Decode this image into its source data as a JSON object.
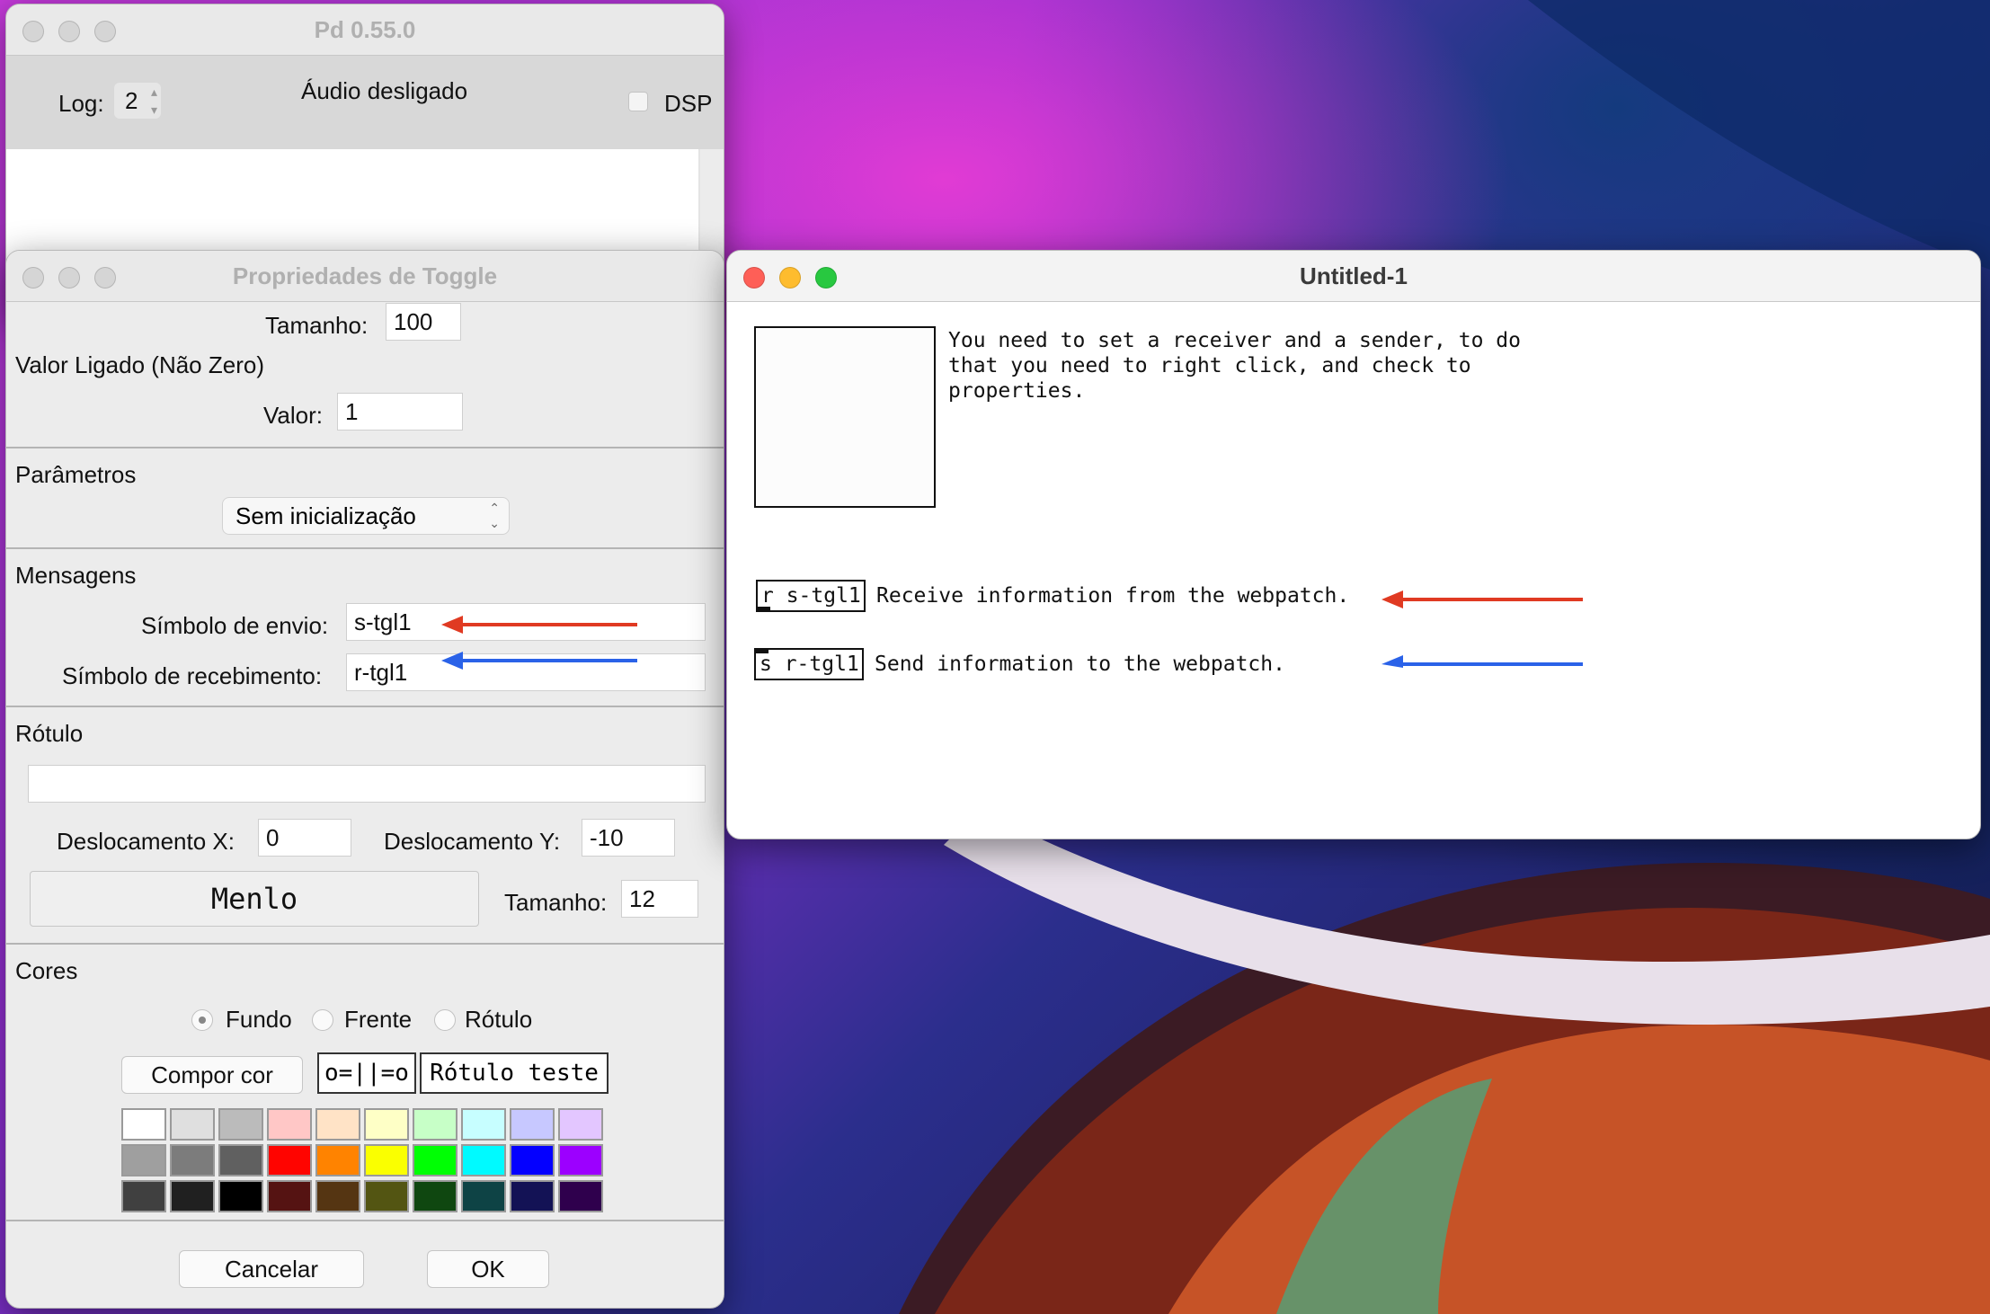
{
  "pd_main": {
    "title": "Pd 0.55.0",
    "log_label": "Log:",
    "log_value": "2",
    "audio_status": "Áudio desligado",
    "dsp_label": "DSP"
  },
  "props": {
    "title": "Propriedades de Toggle",
    "size_label": "Tamanho:",
    "size_value": "100",
    "on_value_heading": "Valor Ligado (Não Zero)",
    "value_label": "Valor:",
    "value_value": "1",
    "params_heading": "Parâmetros",
    "init_select": "Sem inicialização",
    "messages_heading": "Mensagens",
    "send_label": "Símbolo de envio:",
    "send_value": "s-tgl1",
    "receive_label": "Símbolo de recebimento:",
    "receive_value": "r-tgl1",
    "label_heading": "Rótulo",
    "label_value": "",
    "offset_x_label": "Deslocamento X:",
    "offset_x_value": "0",
    "offset_y_label": "Deslocamento Y:",
    "offset_y_value": "-10",
    "font_button": "Menlo",
    "font_size_label": "Tamanho:",
    "font_size_value": "12",
    "colors_heading": "Cores",
    "radio_background": "Fundo",
    "radio_foreground": "Frente",
    "radio_label": "Rótulo",
    "compose_color_button": "Compor cor",
    "preview_toggle": "o=||=o",
    "preview_label": "Rótulo teste",
    "cancel_button": "Cancelar",
    "ok_button": "OK",
    "palette": [
      [
        "#ffffff",
        "#dfdfdf",
        "#bbbbbb",
        "#ffc7c6",
        "#ffe3c6",
        "#feffc6",
        "#c7ffc7",
        "#c7feff",
        "#c7c8ff",
        "#e3c6ff"
      ],
      [
        "#9f9f9f",
        "#7c7c7c",
        "#606060",
        "#ff0400",
        "#ff8300",
        "#faff00",
        "#00ff04",
        "#00faff",
        "#0400ff",
        "#9c00ff"
      ],
      [
        "#404040",
        "#202020",
        "#000000",
        "#551312",
        "#553512",
        "#535512",
        "#0f4710",
        "#0e4345",
        "#131255",
        "#2f004d"
      ]
    ]
  },
  "canvas": {
    "title": "Untitled-1",
    "comment_intro": "You need to set a receiver and a sender, to do\nthat you need to right click, and check to\nproperties.",
    "receive_object": "r s-tgl1",
    "receive_comment": "Receive information from the webpatch.",
    "send_object": "s r-tgl1",
    "send_comment": "Send information to the webpatch."
  },
  "colors": {
    "arrow_red": "#e03a22",
    "arrow_blue": "#2a62e8"
  }
}
